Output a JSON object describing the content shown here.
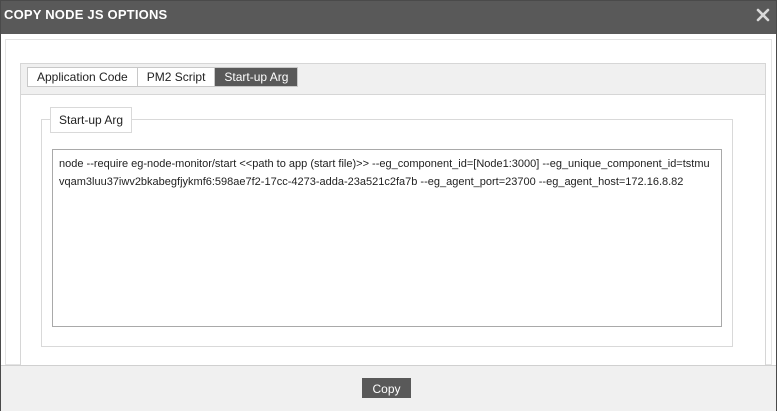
{
  "dialog": {
    "title": "COPY NODE JS OPTIONS",
    "close_icon": "close-icon"
  },
  "tabs": [
    {
      "label": "Application Code",
      "active": false
    },
    {
      "label": "PM2 Script",
      "active": false
    },
    {
      "label": "Start-up Arg",
      "active": true
    }
  ],
  "panel": {
    "legend": "Start-up Arg",
    "text": "node --require eg-node-monitor/start <<path to app (start file)>> --eg_component_id=[Node1:3000] --eg_unique_component_id=tstmuvqam3luu37iwv2bkabegfjykmf6:598ae7f2-17cc-4273-adda-23a521c2fa7b --eg_agent_port=23700 --eg_agent_host=172.16.8.82"
  },
  "footer": {
    "copy_label": "Copy"
  },
  "colors": {
    "titlebar": "#595959",
    "active_tab": "#595959",
    "button": "#595959",
    "footer": "#f0f0f0"
  }
}
